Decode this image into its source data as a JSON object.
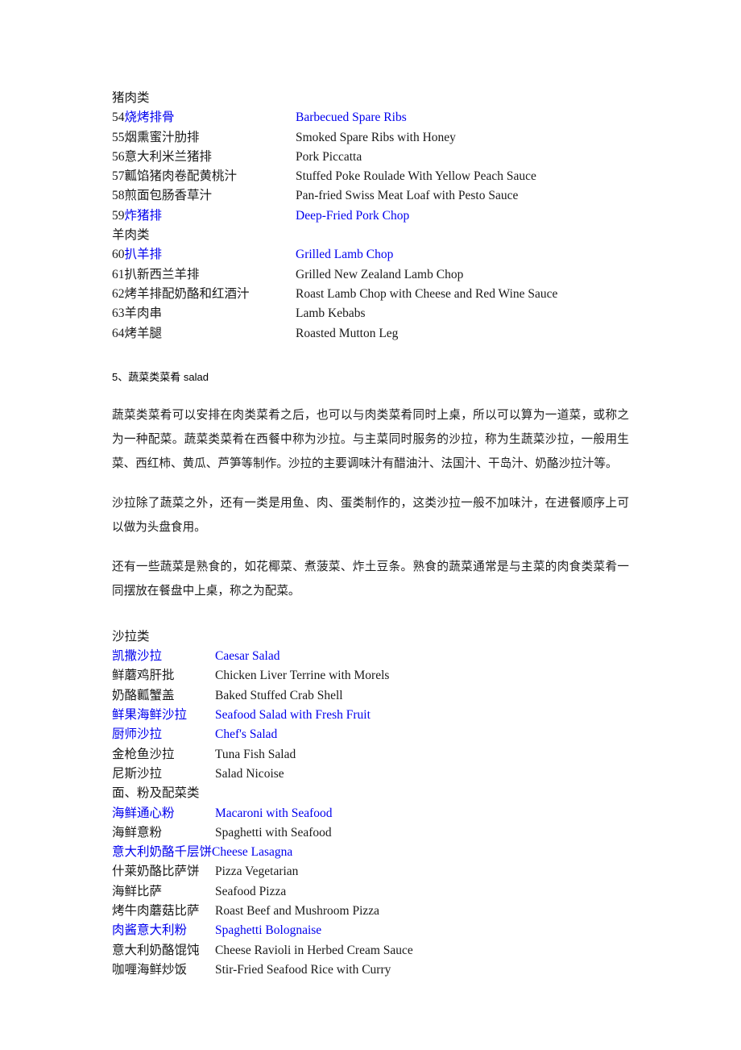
{
  "document": {
    "pork_section": {
      "category_label": "猪肉类",
      "rows": [
        {
          "num": "54",
          "cn": "烧烤排骨",
          "en": "Barbecued Spare Ribs",
          "link": true
        },
        {
          "num": "55",
          "cn": "烟熏蜜汁肋排",
          "en": "Smoked Spare Ribs with Honey",
          "link": false
        },
        {
          "num": "56",
          "cn": "意大利米兰猪排",
          "en": "Pork Piccatta",
          "link": false
        },
        {
          "num": "57",
          "cn": "瓤馅猪肉卷配黄桃汁",
          "en": "Stuffed Poke Roulade With Yellow Peach Sauce",
          "link": false
        },
        {
          "num": "58",
          "cn": "煎面包肠香草汁",
          "en": "Pan-fried Swiss Meat Loaf with Pesto Sauce",
          "link": false
        },
        {
          "num": "59",
          "cn": "炸猪排",
          "en": "Deep-Fried Pork Chop",
          "link": true
        }
      ]
    },
    "lamb_section": {
      "category_label": "羊肉类",
      "rows": [
        {
          "num": "60",
          "cn": "扒羊排",
          "en": "Grilled Lamb Chop",
          "link": true
        },
        {
          "num": "61",
          "cn": "扒新西兰羊排",
          "en": "Grilled New Zealand Lamb Chop",
          "link": false
        },
        {
          "num": "62",
          "cn": "烤羊排配奶酪和红酒汁",
          "en": "Roast Lamb Chop with Cheese and Red Wine Sauce",
          "link": false
        },
        {
          "num": "63",
          "cn": "羊肉串",
          "en": "Lamb Kebabs",
          "link": false
        },
        {
          "num": "64",
          "cn": "烤羊腿",
          "en": "Roasted Mutton Leg",
          "link": false
        }
      ]
    },
    "section_heading": "5、蔬菜类菜肴  salad",
    "paragraphs": [
      "蔬菜类菜肴可以安排在肉类菜肴之后，也可以与肉类菜肴同时上桌，所以可以算为一道菜，或称之为一种配菜。蔬菜类菜肴在西餐中称为沙拉。与主菜同时服务的沙拉，称为生蔬菜沙拉，一般用生菜、西红柿、黄瓜、芦笋等制作。沙拉的主要调味汁有醋油汁、法国汁、干岛汁、奶酪沙拉汁等。",
      "沙拉除了蔬菜之外，还有一类是用鱼、肉、蛋类制作的，这类沙拉一般不加味汁，在进餐顺序上可以做为头盘食用。",
      "还有一些蔬菜是熟食的，如花椰菜、煮菠菜、炸土豆条。熟食的蔬菜通常是与主菜的肉食类菜肴一同摆放在餐盘中上桌，称之为配菜。"
    ],
    "salad_section": {
      "category_label": "沙拉类",
      "rows": [
        {
          "cn": "凯撒沙拉",
          "en": "Caesar Salad",
          "link": true,
          "wide": false
        },
        {
          "cn": "鲜蘑鸡肝批",
          "en": "Chicken Liver Terrine with Morels",
          "link": false,
          "wide": false
        },
        {
          "cn": "奶酪瓤蟹盖",
          "en": "Baked Stuffed Crab Shell",
          "link": false,
          "wide": false
        },
        {
          "cn": "鲜果海鲜沙拉",
          "en": "Seafood Salad with Fresh Fruit",
          "link": true,
          "wide": false
        },
        {
          "cn": "厨师沙拉",
          "en": "Chef's Salad",
          "link": true,
          "wide": false
        },
        {
          "cn": "金枪鱼沙拉",
          "en": "Tuna Fish Salad",
          "link": false,
          "wide": false
        },
        {
          "cn": "尼斯沙拉",
          "en": "Salad Nicoise",
          "link": false,
          "wide": false
        }
      ]
    },
    "pasta_section": {
      "category_label": "面、粉及配菜类",
      "rows": [
        {
          "cn": "海鲜通心粉",
          "en": "Macaroni with Seafood",
          "link": true,
          "wide": false
        },
        {
          "cn": "海鲜意粉",
          "en": "Spaghetti with Seafood",
          "link": false,
          "wide": false
        },
        {
          "cn": "意大利奶酪千层饼",
          "en": "Cheese Lasagna",
          "link": true,
          "wide": true
        },
        {
          "cn": "什莱奶酪比萨饼",
          "en": "Pizza Vegetarian",
          "link": false,
          "wide": false
        },
        {
          "cn": "海鲜比萨",
          "en": "Seafood Pizza",
          "link": false,
          "wide": false
        },
        {
          "cn": "烤牛肉蘑菇比萨",
          "en": "Roast Beef and Mushroom Pizza",
          "link": false,
          "wide": false
        },
        {
          "cn": "肉酱意大利粉",
          "en": "Spaghetti Bolognaise",
          "link": true,
          "wide": false
        },
        {
          "cn": "意大利奶酪馄饨",
          "en": "Cheese Ravioli in Herbed Cream Sauce",
          "link": false,
          "wide": false
        },
        {
          "cn": "咖喱海鲜炒饭",
          "en": "Stir-Fried Seafood Rice with Curry",
          "link": false,
          "wide": false
        }
      ]
    },
    "colors": {
      "link": "#0000ee",
      "text": "#1a1a1a",
      "background": "#ffffff"
    }
  }
}
